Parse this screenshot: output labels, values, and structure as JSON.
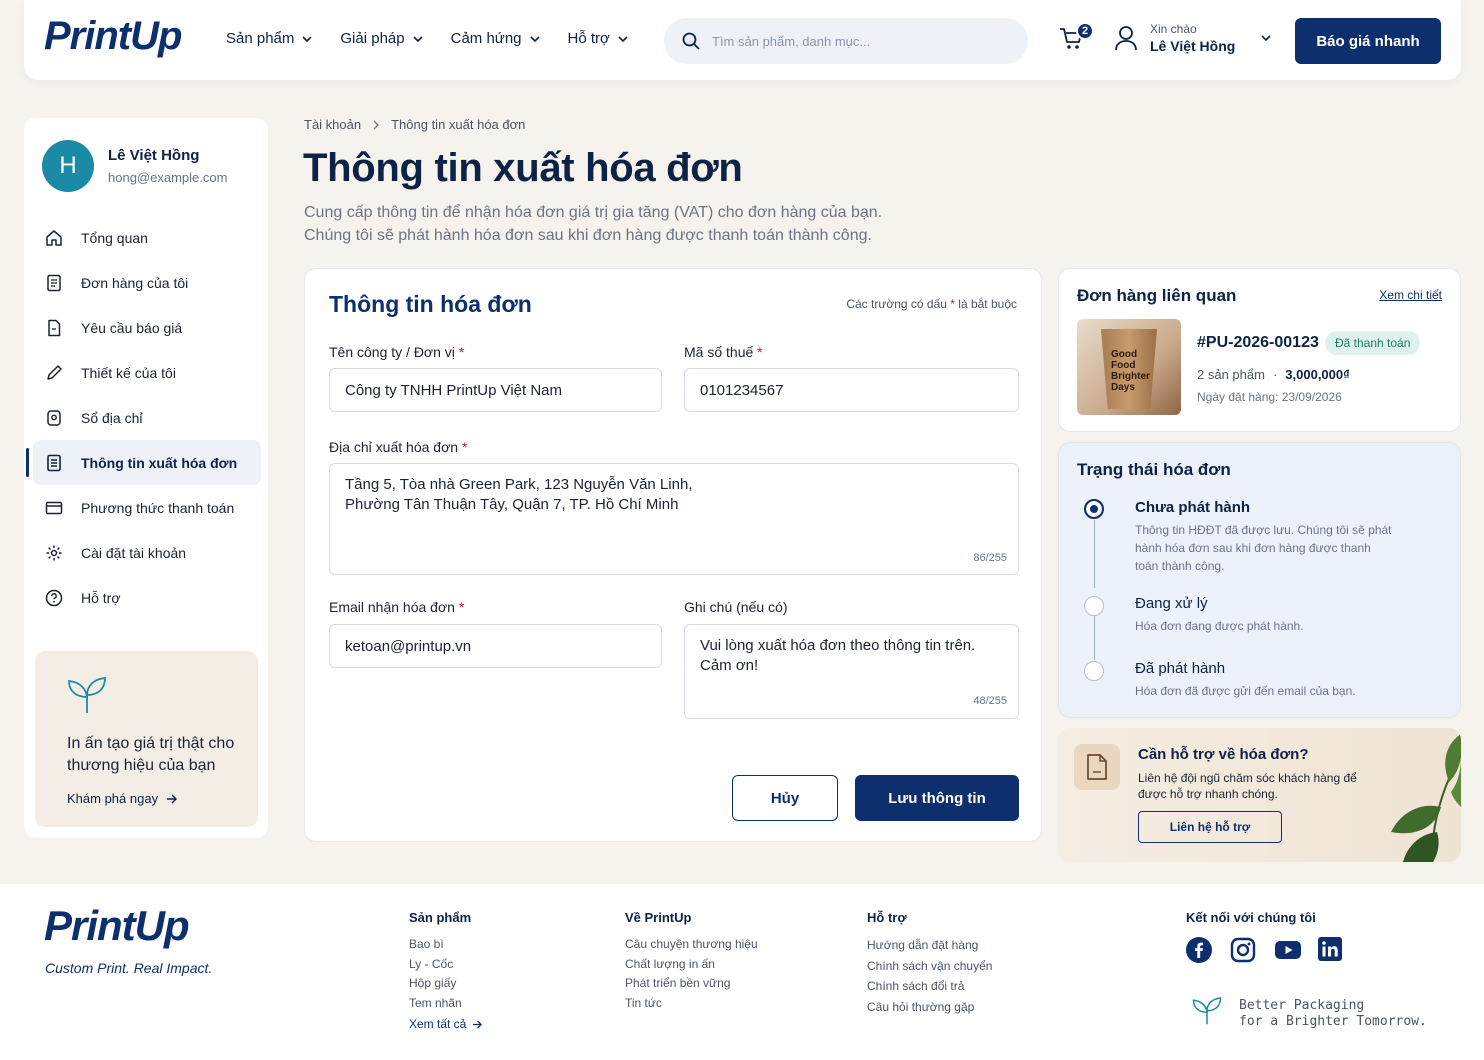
{
  "brand": {
    "name": "PrintUp",
    "tagline": "Custom Print. Real Impact."
  },
  "nav": {
    "items": [
      "Sản phẩm",
      "Giải pháp",
      "Cảm hứng",
      "Hỗ trợ"
    ]
  },
  "search": {
    "placeholder": "Tìm sản phẩm, danh mục..."
  },
  "cart": {
    "count": "2"
  },
  "user": {
    "greeting": "Xin chào",
    "name": "Lê Việt Hồng"
  },
  "header": {
    "quote_button": "Báo giá nhanh"
  },
  "sidebar": {
    "profile": {
      "initial": "H",
      "name": "Lê Việt Hồng",
      "email": "hong@example.com"
    },
    "items": [
      {
        "label": "Tổng quan",
        "icon": "home-icon"
      },
      {
        "label": "Đơn hàng của tôi",
        "icon": "orders-icon"
      },
      {
        "label": "Yêu cầu báo giá",
        "icon": "quote-icon"
      },
      {
        "label": "Thiết kế của tôi",
        "icon": "pencil-icon"
      },
      {
        "label": "Sổ địa chỉ",
        "icon": "location-icon"
      },
      {
        "label": "Thông tin xuất hóa đơn",
        "icon": "invoice-icon",
        "active": true
      },
      {
        "label": "Phương thức thanh toán",
        "icon": "card-icon"
      },
      {
        "label": "Cài đặt tài khoản",
        "icon": "gear-icon"
      },
      {
        "label": "Hỗ trợ",
        "icon": "help-icon"
      }
    ],
    "promo": {
      "text": "In ấn tạo giá trị thật cho thương hiệu của bạn",
      "link": "Khám phá ngay"
    }
  },
  "breadcrumb": [
    "Tài khoản",
    "Thông tin xuất hóa đơn"
  ],
  "page": {
    "title": "Thông tin xuất hóa đơn",
    "description_1": "Cung cấp thông tin để nhận hóa đơn giá trị gia tăng (VAT) cho đơn hàng của bạn.",
    "description_2": "Chúng tôi sẽ phát hành hóa đơn sau khi đơn hàng được thanh toán thành công."
  },
  "form": {
    "title": "Thông tin hóa đơn",
    "required_note_before": "Các trường có dấu ",
    "required_mark": "*",
    "required_note_after": " là bắt buộc",
    "company_label": "Tên công ty / Đơn vị",
    "company_value": "Công ty TNHH PrintUp Việt Nam",
    "tax_label": "Mã số thuế",
    "tax_value": "0101234567",
    "address_label": "Địa chỉ xuất hóa đơn",
    "address_value": "Tầng 5, Tòa nhà Green Park, 123 Nguyễn Văn Linh,\nPhường Tân Thuận Tây, Quận 7, TP. Hồ Chí Minh",
    "address_counter": "86/255",
    "email_label": "Email nhận hóa đơn",
    "email_value": "ketoan@printup.vn",
    "note_label": "Ghi chú (nếu có)",
    "note_value": "Vui lòng xuất hóa đơn theo thông tin trên.\nCảm ơn!",
    "note_counter": "48/255",
    "cancel_label": "Hủy",
    "save_label": "Lưu thông tin"
  },
  "order": {
    "title": "Đơn hàng liên quan",
    "link": "Xem chi tiết",
    "code": "#PU-2026-00123",
    "status": "Đã thanh toán",
    "items": "2 sản phẩm",
    "separator": "·",
    "total": "3,000,000₫",
    "date": "Ngày đặt hàng: 23/09/2026",
    "image_text": "Good Food Brighter Days"
  },
  "invoice_status": {
    "title": "Trạng thái hóa đơn",
    "steps": [
      {
        "title": "Chưa phát hành",
        "desc": "Thông tin HĐĐT đã được lưu. Chúng tôi sẽ phát hành hóa đơn sau khi đơn hàng được thanh toán thành công.",
        "active": true
      },
      {
        "title": "Đang xử lý",
        "desc": "Hóa đơn đang được phát hành."
      },
      {
        "title": "Đã phát hành",
        "desc": "Hóa đơn đã được gửi đến email của bạn."
      }
    ]
  },
  "help": {
    "title": "Cần hỗ trợ về hóa đơn?",
    "desc": "Liên hệ đội ngũ chăm sóc khách hàng để được hỗ trợ nhanh chóng.",
    "button": "Liên hệ hỗ trợ"
  },
  "footer": {
    "products": {
      "title": "Sản phẩm",
      "links": [
        "Bao bì",
        "Ly - Cốc",
        "Hộp giấy",
        "Tem nhãn"
      ],
      "more": "Xem tất cả"
    },
    "about": {
      "title": "Về PrintUp",
      "links": [
        "Câu chuyện thương hiệu",
        "Chất lượng in ấn",
        "Phát triển bền vững",
        "Tin tức"
      ]
    },
    "support": {
      "title": "Hỗ trợ",
      "links": [
        "Hướng dẫn đặt hàng",
        "Chính sách vận chuyển",
        "Chính sách đổi trả",
        "Câu hỏi thường gặp"
      ]
    },
    "social": {
      "title": "Kết nối với chúng tôi",
      "icons": [
        "facebook-icon",
        "instagram-icon",
        "youtube-icon",
        "linkedin-icon"
      ]
    },
    "slogan_1": "Better Packaging",
    "slogan_2": "for a Brighter Tomorrow."
  },
  "colors": {
    "primary": "#0d2f6e",
    "accent": "#1a8aa6",
    "background": "#f6f2ed",
    "required": "#c8102e",
    "paid_badge": "#dff1ec"
  }
}
